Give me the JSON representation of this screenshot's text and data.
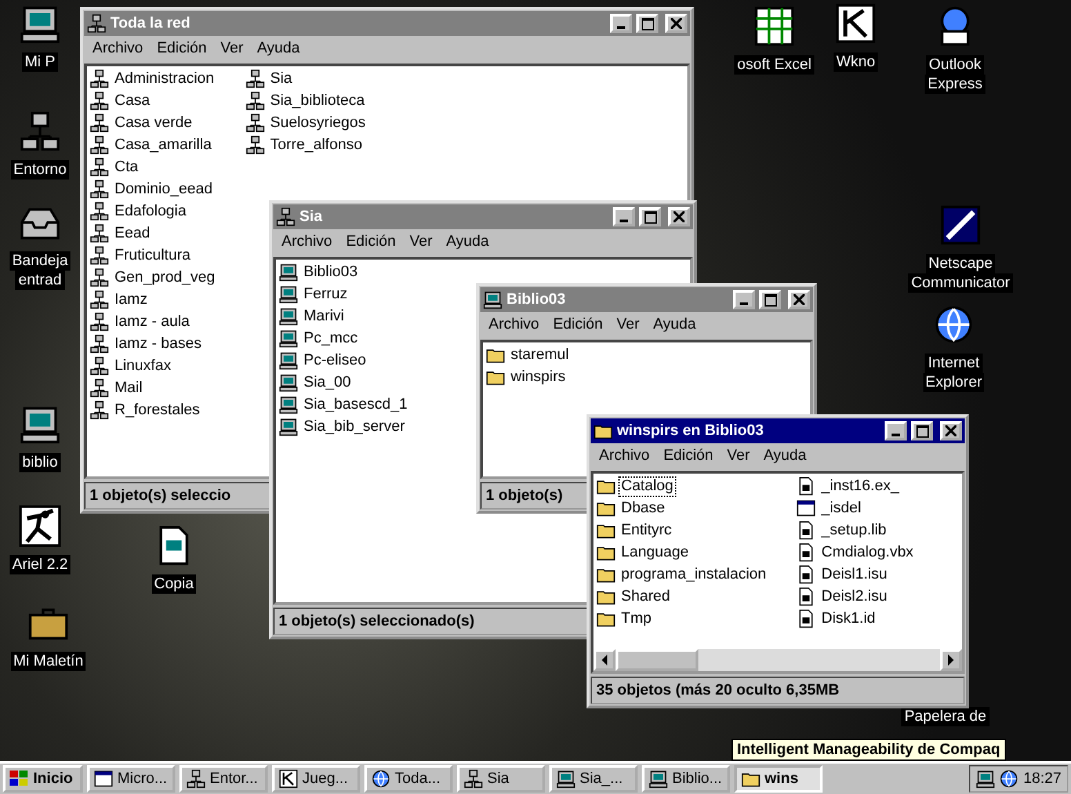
{
  "desktop_icons": [
    {
      "kind": "computer",
      "lines": [
        "Mi P"
      ]
    },
    {
      "kind": "network",
      "lines": [
        "Entorno"
      ]
    },
    {
      "kind": "inbox",
      "lines": [
        "Bandeja",
        "entrad"
      ]
    },
    {
      "kind": "computer",
      "lines": [
        "biblio"
      ]
    },
    {
      "kind": "figure",
      "lines": [
        "Ariel 2.2"
      ]
    },
    {
      "kind": "document",
      "lines": [
        "Copia"
      ]
    },
    {
      "kind": "briefcase",
      "lines": [
        "Mi Maletín"
      ]
    },
    {
      "kind": "spreadsheet",
      "lines": [
        "osoft Excel"
      ]
    },
    {
      "kind": "app",
      "lines": [
        "Wkno"
      ]
    },
    {
      "kind": "mail",
      "lines": [
        "Outlook",
        "Express"
      ]
    },
    {
      "kind": "square",
      "lines": [
        "Netscape",
        "Communicator"
      ]
    },
    {
      "kind": "globe",
      "lines": [
        "Internet",
        "Explorer"
      ]
    },
    {
      "kind": "none",
      "lines": [
        "Papelera de"
      ]
    }
  ],
  "windows": [
    {
      "title": "Toda la red",
      "kind": "network",
      "active": false,
      "menu": [
        "Archivo",
        "Edición",
        "Ver",
        "Ayuda"
      ],
      "columns": [
        [
          {
            "label": "Administracion",
            "kind": "network"
          },
          {
            "label": "Casa",
            "kind": "network"
          },
          {
            "label": "Casa verde",
            "kind": "network"
          },
          {
            "label": "Casa_amarilla",
            "kind": "network"
          },
          {
            "label": "Cta",
            "kind": "network"
          },
          {
            "label": "Dominio_eead",
            "kind": "network"
          },
          {
            "label": "Edafologia",
            "kind": "network"
          },
          {
            "label": "Eead",
            "kind": "network"
          },
          {
            "label": "Fruticultura",
            "kind": "network"
          },
          {
            "label": "Gen_prod_veg",
            "kind": "network"
          },
          {
            "label": "Iamz",
            "kind": "network"
          },
          {
            "label": "Iamz - aula",
            "kind": "network"
          },
          {
            "label": "Iamz - bases",
            "kind": "network"
          },
          {
            "label": "Linuxfax",
            "kind": "network"
          },
          {
            "label": "Mail",
            "kind": "network"
          },
          {
            "label": "R_forestales",
            "kind": "network"
          }
        ],
        [
          {
            "label": "Sia",
            "kind": "network"
          },
          {
            "label": "Sia_biblioteca",
            "kind": "network"
          },
          {
            "label": "Suelosyriegos",
            "kind": "network"
          },
          {
            "label": "Torre_alfonso",
            "kind": "network"
          }
        ]
      ],
      "status": "1 objeto(s) seleccio"
    },
    {
      "title": "Sia",
      "kind": "network",
      "active": false,
      "menu": [
        "Archivo",
        "Edición",
        "Ver",
        "Ayuda"
      ],
      "columns": [
        [
          {
            "label": "Biblio03",
            "kind": "computer"
          },
          {
            "label": "Ferruz",
            "kind": "computer"
          },
          {
            "label": "Marivi",
            "kind": "computer"
          },
          {
            "label": "Pc_mcc",
            "kind": "computer"
          },
          {
            "label": "Pc-eliseo",
            "kind": "computer"
          },
          {
            "label": "Sia_00",
            "kind": "computer"
          },
          {
            "label": "Sia_basescd_1",
            "kind": "computer"
          },
          {
            "label": "Sia_bib_server",
            "kind": "computer"
          }
        ]
      ],
      "status": "1 objeto(s) seleccionado(s)"
    },
    {
      "title": "Biblio03",
      "kind": "computer",
      "active": false,
      "menu": [
        "Archivo",
        "Edición",
        "Ver",
        "Ayuda"
      ],
      "columns": [
        [
          {
            "label": "staremul",
            "kind": "folder"
          },
          {
            "label": "winspirs",
            "kind": "folder"
          }
        ]
      ],
      "status": "1 objeto(s)"
    },
    {
      "title": "winspirs en Biblio03",
      "kind": "folder",
      "active": true,
      "menu": [
        "Archivo",
        "Edición",
        "Ver",
        "Ayuda"
      ],
      "columns": [
        [
          {
            "label": "Catalog",
            "kind": "folder",
            "selected": true
          },
          {
            "label": "Dbase",
            "kind": "folder",
            "selected": false
          },
          {
            "label": "Entityrc",
            "kind": "folder",
            "selected": false
          },
          {
            "label": "Language",
            "kind": "folder",
            "selected": false
          },
          {
            "label": "programa_instalacion",
            "kind": "folder",
            "selected": false
          },
          {
            "label": "Shared",
            "kind": "folder",
            "selected": false
          },
          {
            "label": "Tmp",
            "kind": "folder",
            "selected": false
          }
        ],
        [
          {
            "label": "_inst16.ex_",
            "kind": "file",
            "selected": false
          },
          {
            "label": "_isdel",
            "kind": "window",
            "selected": false
          },
          {
            "label": "_setup.lib",
            "kind": "file",
            "selected": false
          },
          {
            "label": "Cmdialog.vbx",
            "kind": "file",
            "selected": false
          },
          {
            "label": "Deisl1.isu",
            "kind": "file",
            "selected": false
          },
          {
            "label": "Deisl2.isu",
            "kind": "file",
            "selected": false
          },
          {
            "label": "Disk1.id",
            "kind": "file",
            "selected": false
          }
        ]
      ],
      "scrollbar": true,
      "status": "35 objetos (más 20 oculto 6,35MB"
    }
  ],
  "tooltip": "Intelligent Manageability de Compaq",
  "taskbar": {
    "start": "Inicio",
    "buttons": [
      {
        "label": "Micro...",
        "kind": "window",
        "selected": false
      },
      {
        "label": "Entor...",
        "kind": "network",
        "selected": false
      },
      {
        "label": "Jueg...",
        "kind": "app",
        "selected": false
      },
      {
        "label": "Toda...",
        "kind": "globe",
        "selected": false
      },
      {
        "label": "Sia",
        "kind": "network",
        "selected": false
      },
      {
        "label": "Sia_...",
        "kind": "computer",
        "selected": false
      },
      {
        "label": "Biblio...",
        "kind": "computer",
        "selected": false
      },
      {
        "label": "wins",
        "kind": "folder",
        "selected": true
      }
    ],
    "clock": "18:27"
  }
}
